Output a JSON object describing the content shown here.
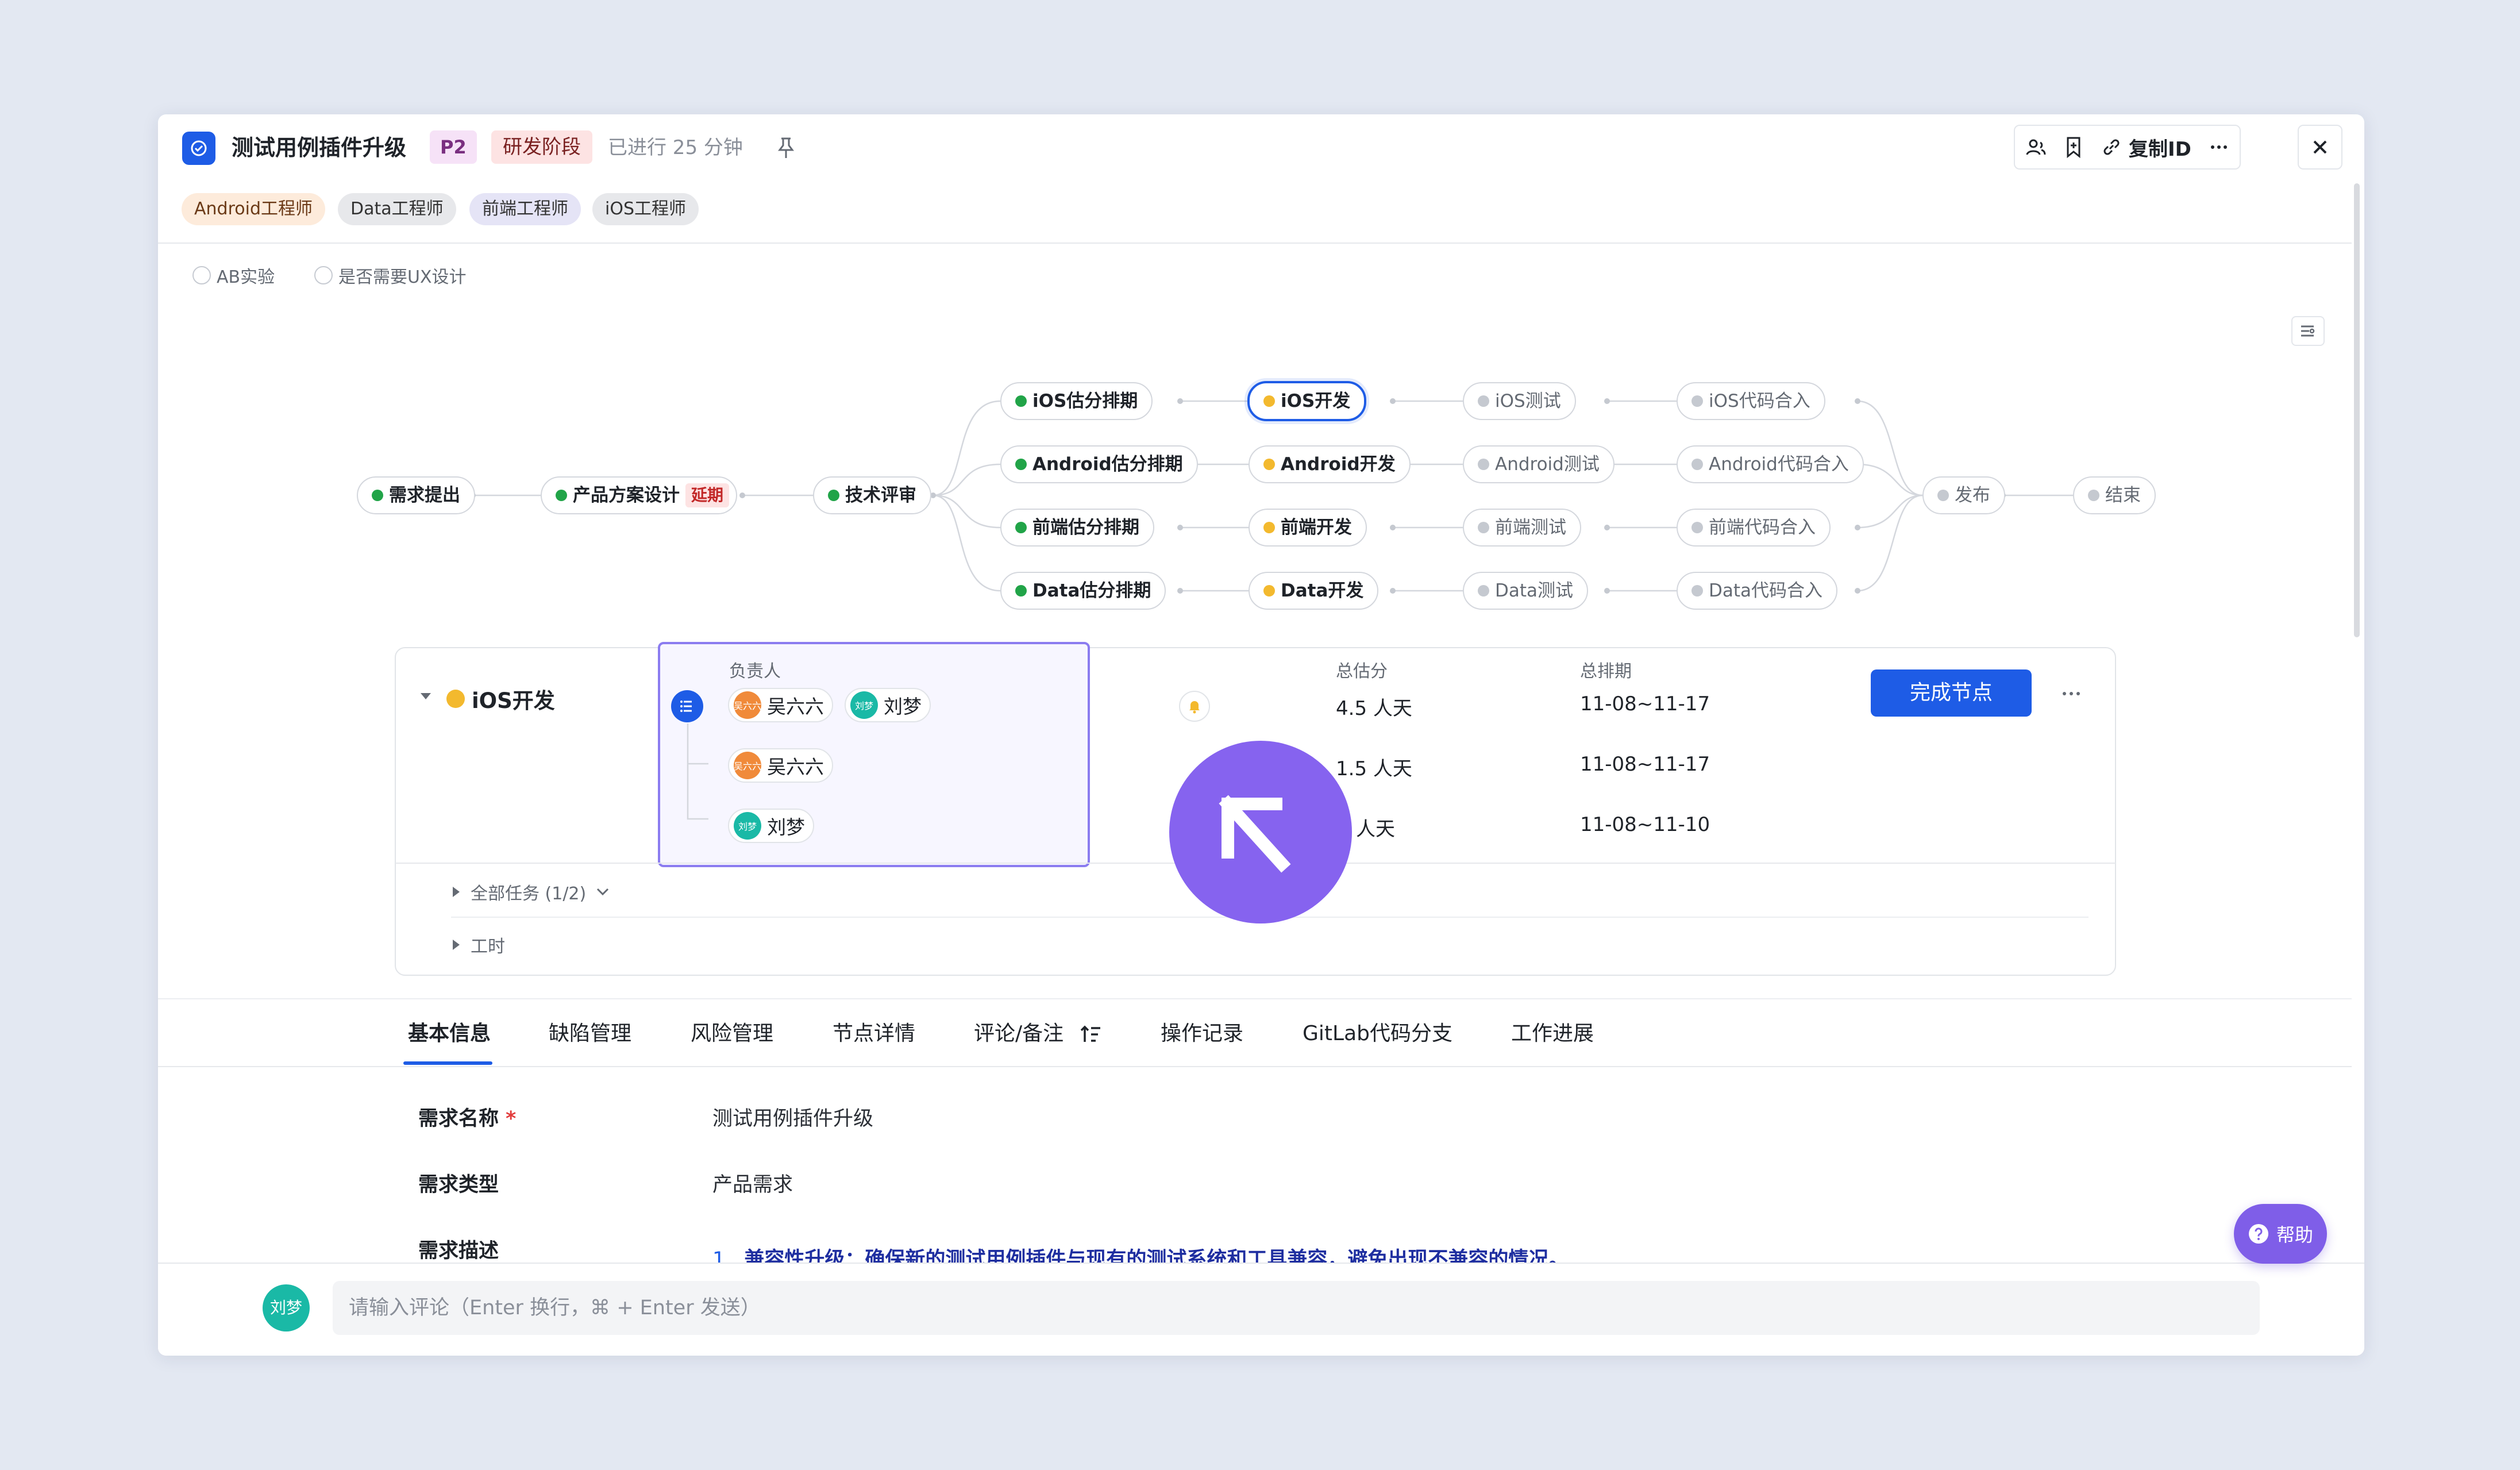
{
  "header": {
    "title": "测试用例插件升级",
    "priority": "P2",
    "stage": "研发阶段",
    "elapsed": "已进行 25 分钟",
    "copy_id_label": "复制ID"
  },
  "roles": [
    "Android工程师",
    "Data工程师",
    "前端工程师",
    "iOS工程师"
  ],
  "options": [
    "AB实验",
    "是否需要UX设计"
  ],
  "flow": {
    "start": "需求提出",
    "design": "产品方案设计",
    "design_tag": "延期",
    "review": "技术评审",
    "estimate": [
      "iOS估分排期",
      "Android估分排期",
      "前端估分排期",
      "Data估分排期"
    ],
    "develop": [
      "iOS开发",
      "Android开发",
      "前端开发",
      "Data开发"
    ],
    "test": [
      "iOS测试",
      "Android测试",
      "前端测试",
      "Data测试"
    ],
    "merge": [
      "iOS代码合入",
      "Android代码合入",
      "前端代码合入",
      "Data代码合入"
    ],
    "release": "发布",
    "end": "结束"
  },
  "node_detail": {
    "name": "iOS开发",
    "owner_label": "负责人",
    "estimate_label": "总估分",
    "schedule_label": "总排期",
    "done_button": "完成节点",
    "rows": [
      {
        "owners": [
          {
            "name": "吴六六",
            "avatar": "吴六六"
          },
          {
            "name": "刘梦",
            "avatar": "刘梦"
          }
        ],
        "estimate": "4.5 人天",
        "schedule": "11-08~11-17"
      },
      {
        "owners": [
          {
            "name": "吴六六",
            "avatar": "吴六六"
          }
        ],
        "estimate": "1.5 人天",
        "schedule": "11-08~11-17"
      },
      {
        "owners": [
          {
            "name": "刘梦",
            "avatar": "刘梦"
          }
        ],
        "estimate": "人天",
        "schedule": "11-08~11-10"
      }
    ],
    "all_tasks": "全部任务 (1/2)",
    "work_hours": "工时"
  },
  "tabs": [
    "基本信息",
    "缺陷管理",
    "风险管理",
    "节点详情",
    "评论/备注",
    "操作记录",
    "GitLab代码分支",
    "工作进展"
  ],
  "fields": [
    {
      "label": "需求名称",
      "value": "测试用例插件升级",
      "required": "*"
    },
    {
      "label": "需求类型",
      "value": "产品需求"
    },
    {
      "label": "需求描述",
      "value": "兼容性升级：确保新的测试用例插件与现有的测试系统和工具兼容，避免出现不兼容的情况。",
      "list_num": "1."
    }
  ],
  "comment": {
    "avatar": "刘梦",
    "placeholder": "请输入评论（Enter 换行，⌘ + Enter 发送）"
  },
  "help_label": "帮助",
  "colors": {
    "accent": "#1e5ce6",
    "done": "#21a448",
    "doing": "#f3b92e",
    "todo": "#c5c9d0",
    "cursor": "#8663ef"
  }
}
